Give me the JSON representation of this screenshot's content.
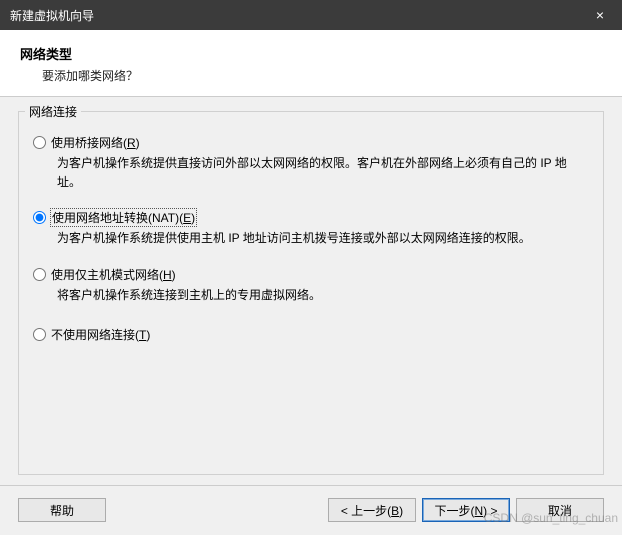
{
  "window": {
    "title": "新建虚拟机向导",
    "close_icon_label": "×"
  },
  "header": {
    "title": "网络类型",
    "subtitle": "要添加哪类网络？"
  },
  "group": {
    "legend": "网络连接",
    "options": {
      "bridged": {
        "label_pre": "使用桥接网络(",
        "label_hot": "R",
        "label_post": ")",
        "desc": "为客户机操作系统提供直接访问外部以太网网络的权限。客户机在外部网络上必须有自己的 IP 地址。"
      },
      "nat": {
        "label_pre": "使用网络地址转换(NAT)(",
        "label_hot": "E",
        "label_post": ")",
        "desc": "为客户机操作系统提供使用主机 IP 地址访问主机拨号连接或外部以太网网络连接的权限。"
      },
      "hostonly": {
        "label_pre": "使用仅主机模式网络(",
        "label_hot": "H",
        "label_post": ")",
        "desc": "将客户机操作系统连接到主机上的专用虚拟网络。"
      },
      "none": {
        "label_pre": "不使用网络连接(",
        "label_hot": "T",
        "label_post": ")"
      }
    }
  },
  "footer": {
    "help": "帮助",
    "back_pre": "< 上一步(",
    "back_hot": "B",
    "back_post": ")",
    "next_pre": "下一步(",
    "next_hot": "N",
    "next_post": ") >",
    "cancel": "取消"
  },
  "watermark": "CSDN @sun_ting_chuan"
}
